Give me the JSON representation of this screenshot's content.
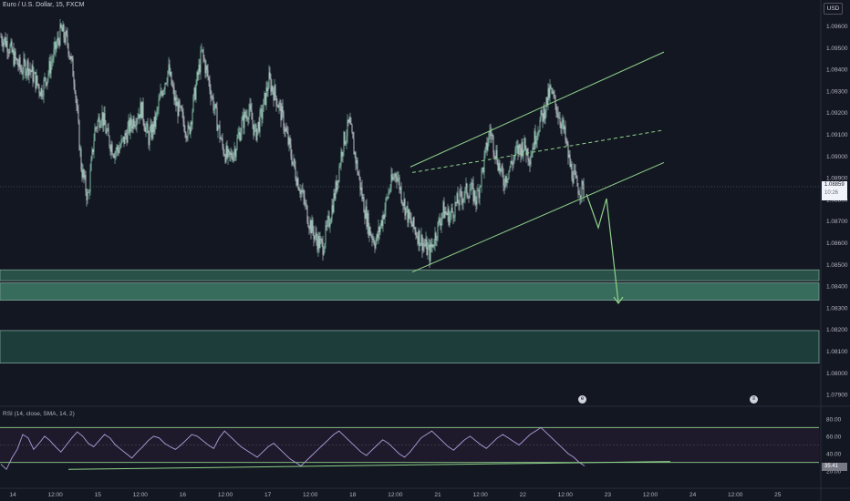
{
  "header": {
    "symbol_title": "Euro / U.S. Dollar, 15, FXCM",
    "currency": "USD"
  },
  "rsi": {
    "legend": "RSI (14, close, SMA, 14, 2)",
    "current_label": "35.41",
    "levels": [
      70,
      30
    ],
    "ticks": [
      "80.00",
      "60.00",
      "40.00",
      "20.00"
    ],
    "series": [
      28,
      22,
      35,
      45,
      62,
      58,
      45,
      52,
      60,
      55,
      48,
      42,
      50,
      58,
      65,
      60,
      52,
      48,
      55,
      62,
      58,
      50,
      45,
      40,
      35,
      42,
      48,
      55,
      60,
      58,
      52,
      48,
      45,
      50,
      56,
      62,
      60,
      55,
      50,
      46,
      58,
      66,
      60,
      54,
      48,
      44,
      40,
      36,
      42,
      48,
      52,
      46,
      40,
      34,
      30,
      26,
      32,
      38,
      44,
      50,
      56,
      62,
      66,
      60,
      54,
      48,
      42,
      38,
      44,
      50,
      56,
      52,
      46,
      40,
      36,
      42,
      50,
      58,
      62,
      66,
      60,
      54,
      48,
      44,
      50,
      56,
      60,
      55,
      50,
      46,
      52,
      58,
      62,
      58,
      54,
      50,
      56,
      62,
      66,
      70,
      64,
      58,
      52,
      46,
      40,
      36,
      30,
      26
    ]
  },
  "price_label": {
    "price": "1.08859",
    "countdown": "10:26"
  },
  "event_icons": [
    {
      "name": "economic-event-icon",
      "glyph": "e"
    },
    {
      "name": "dividend-event-icon",
      "glyph": "≡"
    }
  ],
  "chart_data": {
    "type": "candlestick",
    "symbol": "Euro / U.S. Dollar, 15, FXCM",
    "timeframe": "15",
    "currency": "USD",
    "y_ticks": [
      1.096,
      1.095,
      1.094,
      1.093,
      1.092,
      1.091,
      1.09,
      1.089,
      1.088,
      1.087,
      1.086,
      1.085,
      1.084,
      1.083,
      1.082,
      1.081,
      1.08,
      1.079
    ],
    "y_tick_labels": [
      "1.09600",
      "1.09500",
      "1.09400",
      "1.09300",
      "1.09200",
      "1.09100",
      "1.09000",
      "1.08900",
      "1.08800",
      "1.08700",
      "1.08600",
      "1.08500",
      "1.08400",
      "1.08300",
      "1.08200",
      "1.08100",
      "1.08000",
      "1.07900"
    ],
    "x_tick_labels": [
      "14",
      "12:00",
      "15",
      "12:00",
      "16",
      "12:00",
      "17",
      "12:00",
      "18",
      "12:00",
      "21",
      "12:00",
      "22",
      "12:00",
      "23",
      "12:00",
      "24",
      "12:00",
      "25"
    ],
    "ylim": [
      1.0785,
      1.0972
    ],
    "current_price": 1.08859,
    "price_path": [
      1.0955,
      1.0952,
      1.0945,
      1.094,
      1.0942,
      1.0936,
      1.093,
      1.0938,
      1.0948,
      1.0958,
      1.0952,
      1.0935,
      1.0895,
      1.088,
      1.0912,
      1.092,
      1.0908,
      1.0902,
      1.0905,
      1.0912,
      1.0918,
      1.0922,
      1.0908,
      1.0915,
      1.093,
      1.094,
      1.0925,
      1.0918,
      1.091,
      1.093,
      1.0948,
      1.0935,
      1.092,
      1.0905,
      1.0898,
      1.0904,
      1.0915,
      1.0922,
      1.091,
      1.092,
      1.0935,
      1.0928,
      1.0918,
      1.0905,
      1.0892,
      1.0882,
      1.087,
      1.0862,
      1.0858,
      1.087,
      1.0885,
      1.0905,
      1.0915,
      1.0898,
      1.088,
      1.0866,
      1.086,
      1.0872,
      1.0885,
      1.0893,
      1.088,
      1.087,
      1.0865,
      1.086,
      1.0855,
      1.0865,
      1.0875,
      1.0872,
      1.0878,
      1.0882,
      1.0885,
      1.088,
      1.0895,
      1.0912,
      1.09,
      1.0888,
      1.0895,
      1.0902,
      1.0905,
      1.09,
      1.0912,
      1.092,
      1.093,
      1.0922,
      1.0912,
      1.0895,
      1.0886,
      1.0884
    ],
    "zones": [
      {
        "from": 1.08475,
        "to": 1.08425,
        "color": "#2f5c4f"
      },
      {
        "from": 1.08415,
        "to": 1.08335,
        "color": "#3e7a66"
      },
      {
        "from": 1.08195,
        "to": 1.08045,
        "color": "#1f4440"
      }
    ],
    "channel": {
      "upper": [
        [
          1.0895,
          1.0948
        ]
      ],
      "color": "#8fd18a"
    },
    "projection": {
      "color": "#8fd18a"
    }
  }
}
